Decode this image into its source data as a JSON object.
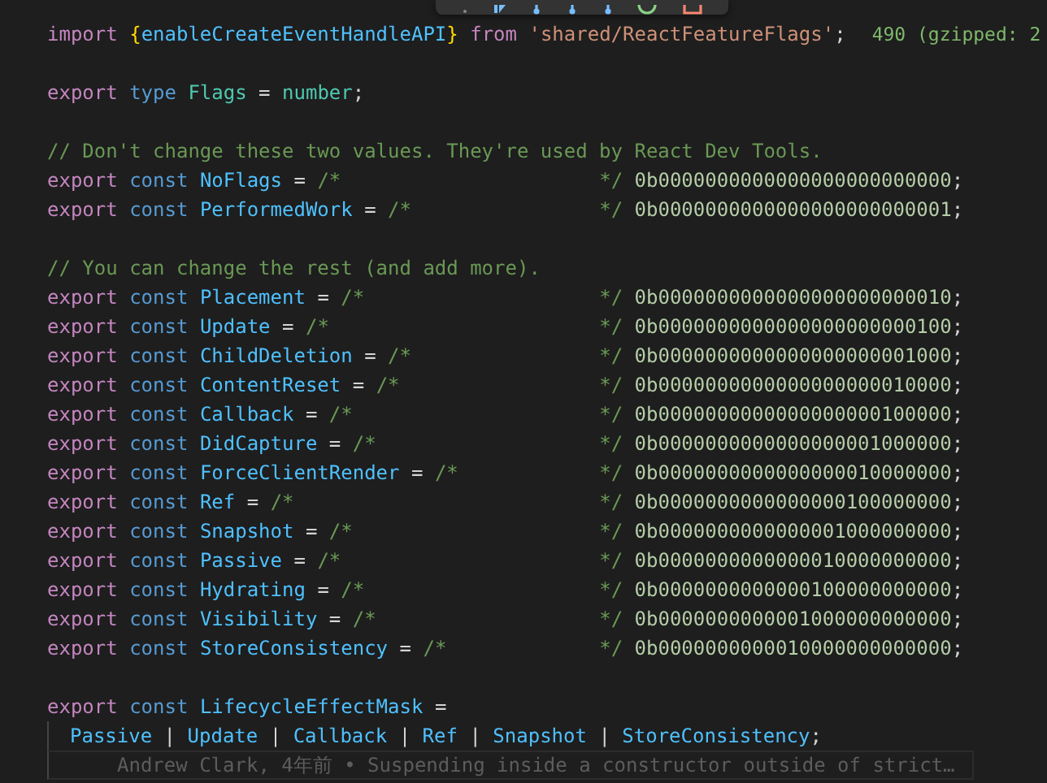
{
  "lines": [
    {
      "kind": "code",
      "tokens": [
        {
          "kind": "keyword",
          "text": "import "
        },
        {
          "kind": "brace",
          "text": "{"
        },
        {
          "kind": "variable",
          "text": "enableCreateEventHandleAPI"
        },
        {
          "kind": "brace",
          "text": "} "
        },
        {
          "kind": "keyword",
          "text": "from "
        },
        {
          "kind": "string",
          "text": "'shared/ReactFeatureFlags'"
        },
        {
          "kind": "punct",
          "text": ";"
        }
      ],
      "hint": "490 (gzipped: 2"
    },
    {
      "kind": "blank"
    },
    {
      "kind": "code",
      "tokens": [
        {
          "kind": "keyword",
          "text": "export "
        },
        {
          "kind": "storage",
          "text": "type "
        },
        {
          "kind": "type",
          "text": "Flags"
        },
        {
          "kind": "punct",
          "text": " = "
        },
        {
          "kind": "type",
          "text": "number"
        },
        {
          "kind": "punct",
          "text": ";"
        }
      ]
    },
    {
      "kind": "blank"
    },
    {
      "kind": "code",
      "tokens": [
        {
          "kind": "comment",
          "text": "// Don't change these two values. They're used by React Dev Tools."
        }
      ]
    },
    {
      "kind": "code",
      "tokens": [
        {
          "kind": "keyword",
          "text": "export "
        },
        {
          "kind": "storage",
          "text": "const "
        },
        {
          "kind": "variable",
          "text": "NoFlags"
        },
        {
          "kind": "punct",
          "text": " = "
        },
        {
          "kind": "comment",
          "text": "/*                      */ "
        },
        {
          "kind": "number",
          "text": "0b0000000000000000000000000"
        },
        {
          "kind": "punct",
          "text": ";"
        }
      ]
    },
    {
      "kind": "code",
      "tokens": [
        {
          "kind": "keyword",
          "text": "export "
        },
        {
          "kind": "storage",
          "text": "const "
        },
        {
          "kind": "variable",
          "text": "PerformedWork"
        },
        {
          "kind": "punct",
          "text": " = "
        },
        {
          "kind": "comment",
          "text": "/*                */ "
        },
        {
          "kind": "number",
          "text": "0b0000000000000000000000001"
        },
        {
          "kind": "punct",
          "text": ";"
        }
      ]
    },
    {
      "kind": "blank"
    },
    {
      "kind": "code",
      "tokens": [
        {
          "kind": "comment",
          "text": "// You can change the rest (and add more)."
        }
      ]
    },
    {
      "kind": "code",
      "tokens": [
        {
          "kind": "keyword",
          "text": "export "
        },
        {
          "kind": "storage",
          "text": "const "
        },
        {
          "kind": "variable",
          "text": "Placement"
        },
        {
          "kind": "punct",
          "text": " = "
        },
        {
          "kind": "comment",
          "text": "/*                    */ "
        },
        {
          "kind": "number",
          "text": "0b0000000000000000000000010"
        },
        {
          "kind": "punct",
          "text": ";"
        }
      ]
    },
    {
      "kind": "code",
      "tokens": [
        {
          "kind": "keyword",
          "text": "export "
        },
        {
          "kind": "storage",
          "text": "const "
        },
        {
          "kind": "variable",
          "text": "Update"
        },
        {
          "kind": "punct",
          "text": " = "
        },
        {
          "kind": "comment",
          "text": "/*                       */ "
        },
        {
          "kind": "number",
          "text": "0b0000000000000000000000100"
        },
        {
          "kind": "punct",
          "text": ";"
        }
      ]
    },
    {
      "kind": "code",
      "tokens": [
        {
          "kind": "keyword",
          "text": "export "
        },
        {
          "kind": "storage",
          "text": "const "
        },
        {
          "kind": "variable",
          "text": "ChildDeletion"
        },
        {
          "kind": "punct",
          "text": " = "
        },
        {
          "kind": "comment",
          "text": "/*                */ "
        },
        {
          "kind": "number",
          "text": "0b0000000000000000000001000"
        },
        {
          "kind": "punct",
          "text": ";"
        }
      ]
    },
    {
      "kind": "code",
      "tokens": [
        {
          "kind": "keyword",
          "text": "export "
        },
        {
          "kind": "storage",
          "text": "const "
        },
        {
          "kind": "variable",
          "text": "ContentReset"
        },
        {
          "kind": "punct",
          "text": " = "
        },
        {
          "kind": "comment",
          "text": "/*                 */ "
        },
        {
          "kind": "number",
          "text": "0b0000000000000000000010000"
        },
        {
          "kind": "punct",
          "text": ";"
        }
      ]
    },
    {
      "kind": "code",
      "tokens": [
        {
          "kind": "keyword",
          "text": "export "
        },
        {
          "kind": "storage",
          "text": "const "
        },
        {
          "kind": "variable",
          "text": "Callback"
        },
        {
          "kind": "punct",
          "text": " = "
        },
        {
          "kind": "comment",
          "text": "/*                     */ "
        },
        {
          "kind": "number",
          "text": "0b0000000000000000000100000"
        },
        {
          "kind": "punct",
          "text": ";"
        }
      ]
    },
    {
      "kind": "code",
      "tokens": [
        {
          "kind": "keyword",
          "text": "export "
        },
        {
          "kind": "storage",
          "text": "const "
        },
        {
          "kind": "variable",
          "text": "DidCapture"
        },
        {
          "kind": "punct",
          "text": " = "
        },
        {
          "kind": "comment",
          "text": "/*                   */ "
        },
        {
          "kind": "number",
          "text": "0b0000000000000000001000000"
        },
        {
          "kind": "punct",
          "text": ";"
        }
      ]
    },
    {
      "kind": "code",
      "tokens": [
        {
          "kind": "keyword",
          "text": "export "
        },
        {
          "kind": "storage",
          "text": "const "
        },
        {
          "kind": "variable",
          "text": "ForceClientRender"
        },
        {
          "kind": "punct",
          "text": " = "
        },
        {
          "kind": "comment",
          "text": "/*            */ "
        },
        {
          "kind": "number",
          "text": "0b0000000000000000010000000"
        },
        {
          "kind": "punct",
          "text": ";"
        }
      ]
    },
    {
      "kind": "code",
      "tokens": [
        {
          "kind": "keyword",
          "text": "export "
        },
        {
          "kind": "storage",
          "text": "const "
        },
        {
          "kind": "variable",
          "text": "Ref"
        },
        {
          "kind": "punct",
          "text": " = "
        },
        {
          "kind": "comment",
          "text": "/*                          */ "
        },
        {
          "kind": "number",
          "text": "0b0000000000000000100000000"
        },
        {
          "kind": "punct",
          "text": ";"
        }
      ]
    },
    {
      "kind": "code",
      "tokens": [
        {
          "kind": "keyword",
          "text": "export "
        },
        {
          "kind": "storage",
          "text": "const "
        },
        {
          "kind": "variable",
          "text": "Snapshot"
        },
        {
          "kind": "punct",
          "text": " = "
        },
        {
          "kind": "comment",
          "text": "/*                     */ "
        },
        {
          "kind": "number",
          "text": "0b0000000000000001000000000"
        },
        {
          "kind": "punct",
          "text": ";"
        }
      ]
    },
    {
      "kind": "code",
      "tokens": [
        {
          "kind": "keyword",
          "text": "export "
        },
        {
          "kind": "storage",
          "text": "const "
        },
        {
          "kind": "variable",
          "text": "Passive"
        },
        {
          "kind": "punct",
          "text": " = "
        },
        {
          "kind": "comment",
          "text": "/*                      */ "
        },
        {
          "kind": "number",
          "text": "0b0000000000000010000000000"
        },
        {
          "kind": "punct",
          "text": ";"
        }
      ]
    },
    {
      "kind": "code",
      "tokens": [
        {
          "kind": "keyword",
          "text": "export "
        },
        {
          "kind": "storage",
          "text": "const "
        },
        {
          "kind": "variable",
          "text": "Hydrating"
        },
        {
          "kind": "punct",
          "text": " = "
        },
        {
          "kind": "comment",
          "text": "/*                    */ "
        },
        {
          "kind": "number",
          "text": "0b0000000000000100000000000"
        },
        {
          "kind": "punct",
          "text": ";"
        }
      ]
    },
    {
      "kind": "code",
      "tokens": [
        {
          "kind": "keyword",
          "text": "export "
        },
        {
          "kind": "storage",
          "text": "const "
        },
        {
          "kind": "variable",
          "text": "Visibility"
        },
        {
          "kind": "punct",
          "text": " = "
        },
        {
          "kind": "comment",
          "text": "/*                   */ "
        },
        {
          "kind": "number",
          "text": "0b0000000000001000000000000"
        },
        {
          "kind": "punct",
          "text": ";"
        }
      ]
    },
    {
      "kind": "code",
      "tokens": [
        {
          "kind": "keyword",
          "text": "export "
        },
        {
          "kind": "storage",
          "text": "const "
        },
        {
          "kind": "variable",
          "text": "StoreConsistency"
        },
        {
          "kind": "punct",
          "text": " = "
        },
        {
          "kind": "comment",
          "text": "/*             */ "
        },
        {
          "kind": "number",
          "text": "0b0000000000010000000000000"
        },
        {
          "kind": "punct",
          "text": ";"
        }
      ]
    },
    {
      "kind": "blank"
    },
    {
      "kind": "code",
      "tokens": [
        {
          "kind": "keyword",
          "text": "export "
        },
        {
          "kind": "storage",
          "text": "const "
        },
        {
          "kind": "variable",
          "text": "LifecycleEffectMask"
        },
        {
          "kind": "punct",
          "text": " ="
        }
      ]
    },
    {
      "kind": "continuation",
      "tokens": [
        {
          "kind": "variable",
          "text": "Passive"
        },
        {
          "kind": "punct",
          "text": " | "
        },
        {
          "kind": "variable",
          "text": "Update"
        },
        {
          "kind": "punct",
          "text": " | "
        },
        {
          "kind": "variable",
          "text": "Callback"
        },
        {
          "kind": "punct",
          "text": " | "
        },
        {
          "kind": "variable",
          "text": "Ref"
        },
        {
          "kind": "punct",
          "text": " | "
        },
        {
          "kind": "variable",
          "text": "Snapshot"
        },
        {
          "kind": "punct",
          "text": " | "
        },
        {
          "kind": "variable",
          "text": "StoreConsistency"
        },
        {
          "kind": "punct",
          "text": ";"
        }
      ]
    },
    {
      "kind": "blame",
      "text": "Andrew Clark, 4年前 • Suspending inside a constructor outside of strict…"
    }
  ]
}
